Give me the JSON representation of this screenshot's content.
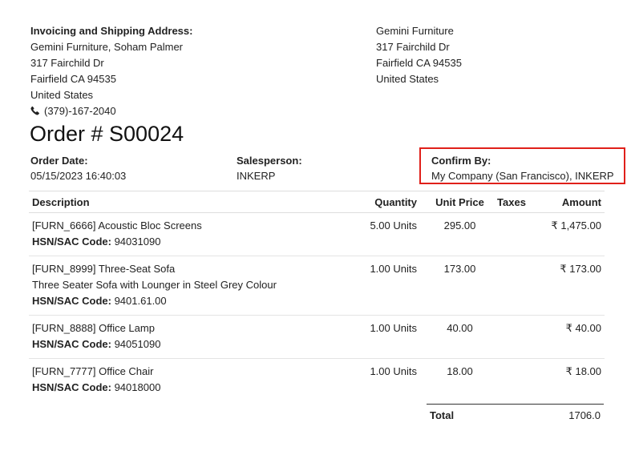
{
  "address_left": {
    "heading": "Invoicing and Shipping Address:",
    "lines": [
      "Gemini Furniture, Soham Palmer",
      "317 Fairchild Dr",
      "Fairfield CA 94535",
      "United States"
    ],
    "phone": "(379)-167-2040"
  },
  "address_right": {
    "lines": [
      "Gemini Furniture",
      "317 Fairchild Dr",
      "Fairfield CA 94535",
      "United States"
    ]
  },
  "order_title": "Order # S00024",
  "meta": {
    "order_date_label": "Order Date:",
    "order_date": "05/15/2023 16:40:03",
    "salesperson_label": "Salesperson:",
    "salesperson": "INKERP",
    "confirm_label": "Confirm By:",
    "confirm_value": "My Company (San Francisco), INKERP"
  },
  "columns": {
    "description": "Description",
    "quantity": "Quantity",
    "unit_price": "Unit Price",
    "taxes": "Taxes",
    "amount": "Amount"
  },
  "hsn_label": "HSN/SAC Code:",
  "rows": [
    {
      "name": "[FURN_6666] Acoustic Bloc Screens",
      "extra": "",
      "hsn": "94031090",
      "qty": "5.00 Units",
      "price": "295.00",
      "taxes": "",
      "amount": "₹ 1,475.00"
    },
    {
      "name": "[FURN_8999] Three-Seat Sofa",
      "extra": "Three Seater Sofa with Lounger in Steel Grey Colour",
      "hsn": "9401.61.00",
      "qty": "1.00 Units",
      "price": "173.00",
      "taxes": "",
      "amount": "₹ 173.00"
    },
    {
      "name": "[FURN_8888] Office Lamp",
      "extra": "",
      "hsn": "94051090",
      "qty": "1.00 Units",
      "price": "40.00",
      "taxes": "",
      "amount": "₹ 40.00"
    },
    {
      "name": "[FURN_7777] Office Chair",
      "extra": "",
      "hsn": "94018000",
      "qty": "1.00 Units",
      "price": "18.00",
      "taxes": "",
      "amount": "₹ 18.00"
    }
  ],
  "total": {
    "label": "Total",
    "value": "1706.0"
  },
  "colors": {
    "highlight": "#e0201a",
    "text": "#222222"
  }
}
